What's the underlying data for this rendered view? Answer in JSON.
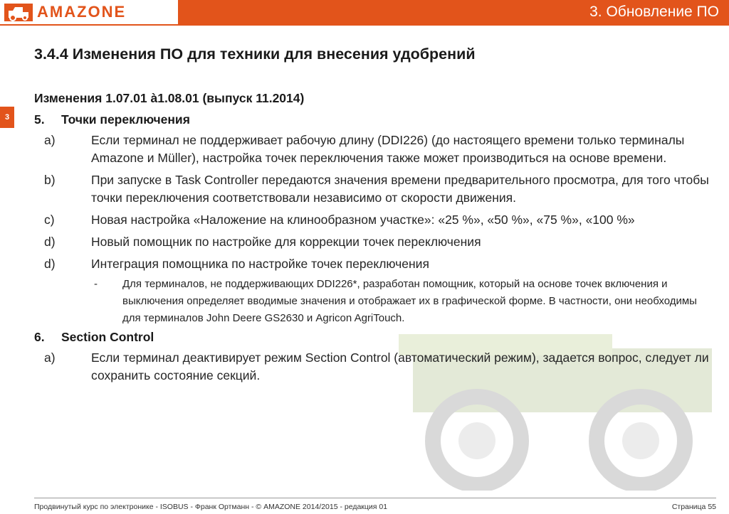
{
  "header": {
    "logo_text": "AMAZONE",
    "section_title": "3.  Обновление ПО"
  },
  "chapter_tab": "3",
  "page_heading": "3.4.4 Изменения ПО для техники для внесения удобрений",
  "changes_title": "Изменения 1.07.01 à1.08.01 (выпуск 11.2014)",
  "sections": [
    {
      "num": "5.",
      "title": "Точки переключения",
      "items": [
        {
          "mk": "a)",
          "text": "Если терминал не поддерживает рабочую длину (DDI226) (до настоящего времени только терминалы Amazone и Müller), настройка точек переключения также может производиться на основе времени."
        },
        {
          "mk": "b)",
          "text": "При запуске в Task Controller передаются значения времени предварительного просмотра, для того чтобы точки переключения соответствовали независимо от скорости движения."
        },
        {
          "mk": "c)",
          "text": "Новая настройка «Наложение на клинообразном участке»: «25 %», «50 %», «75 %», «100 %»"
        },
        {
          "mk": "d)",
          "text": "Новый помощник по настройке для коррекции точек переключения"
        },
        {
          "mk": "d)",
          "text": "Интеграция помощника по настройке точек переключения"
        }
      ],
      "sub": {
        "mk": "-",
        "text": "Для терминалов, не поддерживающих DDI226*, разработан помощник, который на основе точек включения и выключения определяет вводимые значения и отображает их в графической форме. В частности, они необходимы для терминалов John Deere GS2630 и Agricon AgriTouch."
      }
    },
    {
      "num": "6.",
      "title": "Section Control",
      "items": [
        {
          "mk": "a)",
          "text": "Если терминал деактивирует режим Section Control (автоматический режим), задается вопрос, следует ли сохранить состояние секций."
        }
      ]
    }
  ],
  "footer": {
    "left": "Продвинутый курс по электронике - ISOBUS - Франк Ортманн - © AMAZONE 2014/2015 - редакция 01",
    "right": "Страница 55"
  },
  "colors": {
    "brand": "#e2541b",
    "text": "#1a1a1a"
  },
  "icons": [
    "amazone-logo-icon",
    "sprayer-background-image"
  ]
}
